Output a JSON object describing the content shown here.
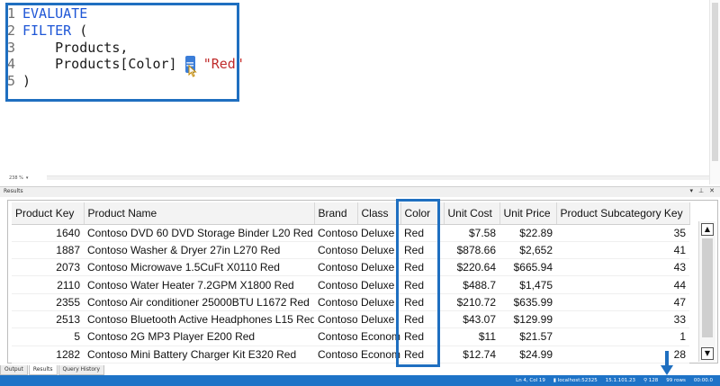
{
  "editor": {
    "lines": [
      {
        "num": "1",
        "parts": [
          {
            "t": "EVALUATE",
            "c": "kw"
          }
        ]
      },
      {
        "num": "2",
        "parts": [
          {
            "t": "FILTER",
            "c": "kw"
          },
          {
            "t": " (",
            "c": "txt"
          }
        ]
      },
      {
        "num": "3",
        "parts": [
          {
            "t": "    Products,",
            "c": "txt"
          }
        ]
      },
      {
        "num": "4",
        "parts": [
          {
            "t": "    Products[Color] ",
            "c": "txt"
          },
          {
            "t": "=",
            "c": "eqsel"
          },
          {
            "t": " ",
            "c": "txt"
          },
          {
            "t": "\"Red\"",
            "c": "str"
          }
        ]
      },
      {
        "num": "5",
        "parts": [
          {
            "t": ")",
            "c": "txt"
          }
        ]
      }
    ],
    "zoom": "238 %"
  },
  "results": {
    "title": "Results",
    "columns": [
      "Product Key",
      "Product Name",
      "Brand",
      "Class",
      "Color",
      "Unit Cost",
      "Unit Price",
      "Product Subcategory Key"
    ],
    "rows": [
      [
        "1640",
        "Contoso DVD 60 DVD Storage Binder L20 Red",
        "Contoso",
        "Deluxe",
        "Red",
        "$7.58",
        "$22.89",
        "35"
      ],
      [
        "1887",
        "Contoso Washer & Dryer 27in L270 Red",
        "Contoso",
        "Deluxe",
        "Red",
        "$878.66",
        "$2,652",
        "41"
      ],
      [
        "2073",
        "Contoso Microwave 1.5CuFt X0110 Red",
        "Contoso",
        "Deluxe",
        "Red",
        "$220.64",
        "$665.94",
        "43"
      ],
      [
        "2110",
        "Contoso Water Heater 7.2GPM X1800 Red",
        "Contoso",
        "Deluxe",
        "Red",
        "$488.7",
        "$1,475",
        "44"
      ],
      [
        "2355",
        "Contoso Air conditioner 25000BTU L1672 Red",
        "Contoso",
        "Deluxe",
        "Red",
        "$210.72",
        "$635.99",
        "47"
      ],
      [
        "2513",
        "Contoso Bluetooth Active Headphones L15 Red",
        "Contoso",
        "Deluxe",
        "Red",
        "$43.07",
        "$129.99",
        "33"
      ],
      [
        "5",
        "Contoso 2G MP3 Player E200 Red",
        "Contoso",
        "Economy",
        "Red",
        "$11",
        "$21.57",
        "1"
      ],
      [
        "1282",
        "Contoso Mini Battery Charger Kit E320 Red",
        "Contoso",
        "Economy",
        "Red",
        "$12.74",
        "$24.99",
        "28"
      ]
    ]
  },
  "tabs": [
    {
      "label": "Output",
      "active": false
    },
    {
      "label": "Results",
      "active": true
    },
    {
      "label": "Query History",
      "active": false
    }
  ],
  "status": {
    "position": "Ln 4, Col 19",
    "server": "localhost:52325",
    "version": "15.1.101.23",
    "spid": "128",
    "rows": "99 rows",
    "time": "00:00.0"
  },
  "colors": {
    "accent": "#1e73c7",
    "highlight": "#1f6fc0",
    "keyword": "#1e56d6",
    "string": "#c02b2b"
  }
}
